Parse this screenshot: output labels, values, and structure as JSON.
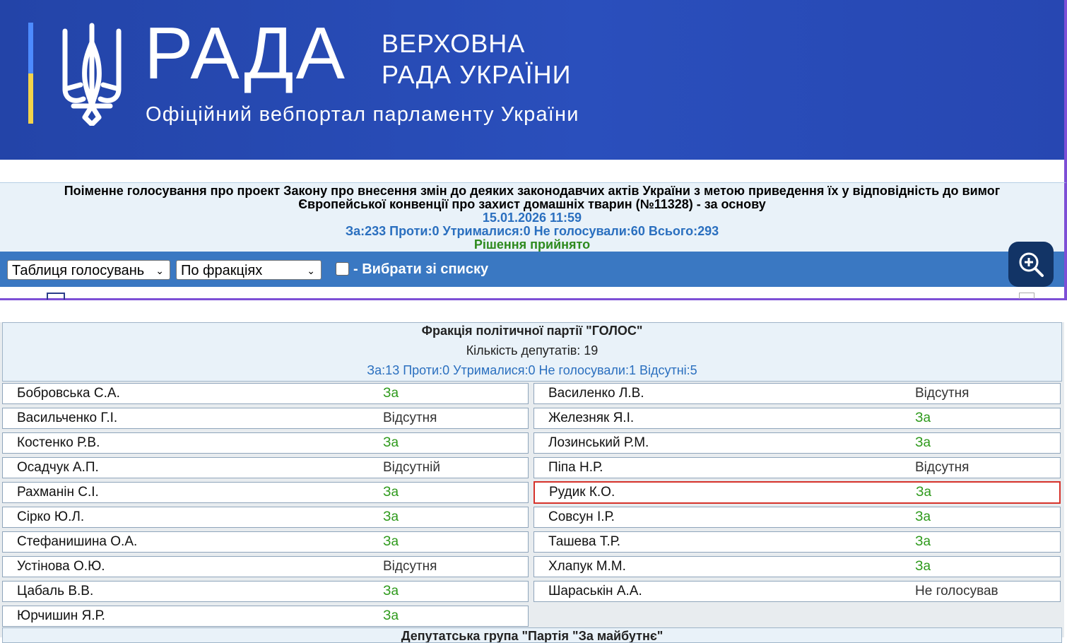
{
  "header": {
    "rada": "РАДА",
    "rada_sub_line1": "ВЕРХОВНА",
    "rada_sub_line2": "РАДА УКРАЇНИ",
    "portal_subtitle": "Офіційний вебпортал парламенту України"
  },
  "vote": {
    "title": "Поіменне голосування про проект Закону про внесення змін до деяких законодавчих актів України з метою приведення їх у відповідність до вимог Європейської конвенції про захист домашніх тварин (№11328) - за основу",
    "datetime": "15.01.2026 11:59",
    "totals": "За:233 Проти:0 Утрималися:0 Не голосували:60 Всього:293",
    "result": "Рішення прийнято"
  },
  "toolbar": {
    "view_select": "Таблиця голосувань",
    "group_select": "По фракціях",
    "pick_label": "- Вибрати зі списку"
  },
  "faction": {
    "name": "Фракція політичної партії \"ГОЛОС\"",
    "count": "Кількість депутатів: 19",
    "totals": "За:13 Проти:0 Утрималися:0 Не голосували:1 Відсутні:5",
    "left": [
      {
        "name": "Бобровська С.А.",
        "vote": "За"
      },
      {
        "name": "Васильченко Г.І.",
        "vote": "Відсутня"
      },
      {
        "name": "Костенко Р.В.",
        "vote": "За"
      },
      {
        "name": "Осадчук А.П.",
        "vote": "Відсутній"
      },
      {
        "name": "Рахманін С.І.",
        "vote": "За"
      },
      {
        "name": "Сірко Ю.Л.",
        "vote": "За"
      },
      {
        "name": "Стефанишина О.А.",
        "vote": "За"
      },
      {
        "name": "Устінова О.Ю.",
        "vote": "Відсутня"
      },
      {
        "name": "Цабаль В.В.",
        "vote": "За"
      },
      {
        "name": "Юрчишин Я.Р.",
        "vote": "За"
      }
    ],
    "right": [
      {
        "name": "Василенко Л.В.",
        "vote": "Відсутня"
      },
      {
        "name": "Железняк Я.І.",
        "vote": "За"
      },
      {
        "name": "Лозинський Р.М.",
        "vote": "За"
      },
      {
        "name": "Піпа Н.Р.",
        "vote": "Відсутня"
      },
      {
        "name": "Рудик К.О.",
        "vote": "За"
      },
      {
        "name": "Совсун І.Р.",
        "vote": "За"
      },
      {
        "name": "Ташева Т.Р.",
        "vote": "За"
      },
      {
        "name": "Хлапук М.М.",
        "vote": "За"
      },
      {
        "name": "Шараськін А.А.",
        "vote": "Не голосував"
      }
    ]
  },
  "next_group": "Депутатська група \"Партія \"За майбутнє\""
}
